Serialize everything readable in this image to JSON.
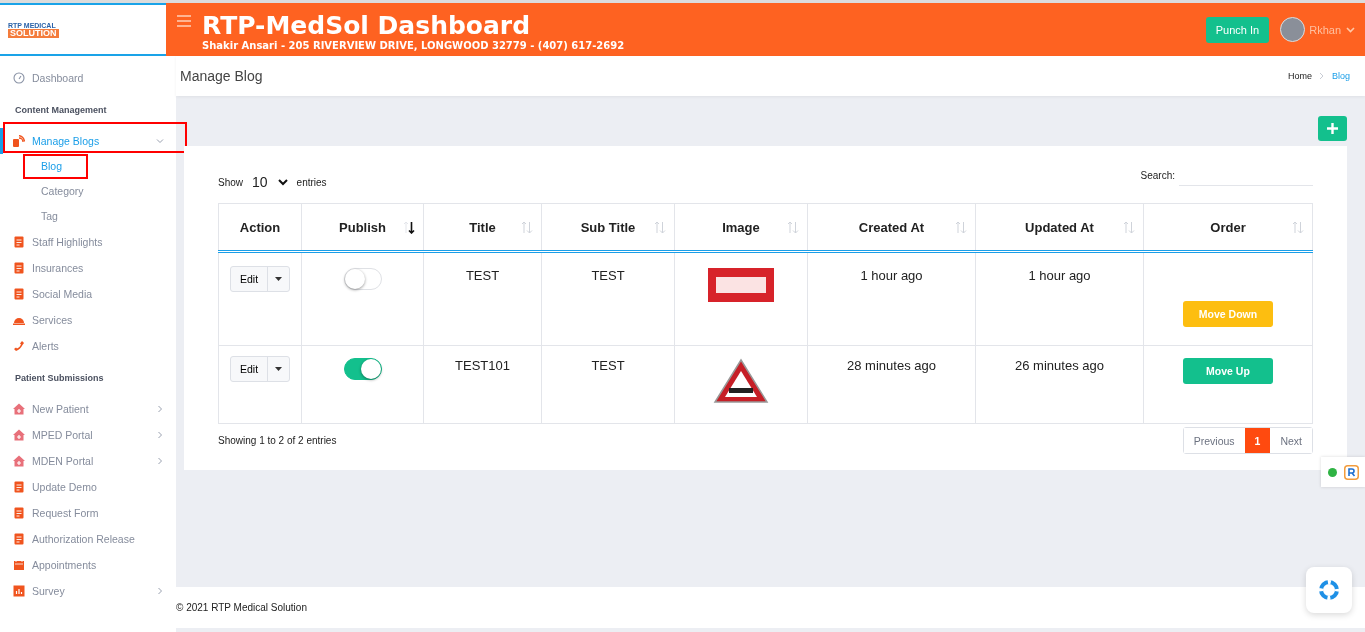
{
  "logo": {
    "line1": "RTP MEDICAL",
    "line2": "SOLUTION"
  },
  "header": {
    "title": "RTP-MedSol Dashboard",
    "subtitle": "Shakir Ansari - 205 RIVERVIEW DRIVE, LONGWOOD 32779 - (407) 617-2692",
    "punch_button": "Punch In",
    "user": "Rkhan"
  },
  "sidebar": {
    "items": [
      {
        "kind": "item",
        "label": "Dashboard",
        "selected": false
      },
      {
        "kind": "section",
        "label": "Content Management"
      },
      {
        "kind": "item",
        "label": "Manage Blogs",
        "selected": true,
        "highlighted": true,
        "expanded": true,
        "children": [
          {
            "label": "Blog",
            "selected": true,
            "highlighted": true
          },
          {
            "label": "Category",
            "selected": false
          },
          {
            "label": "Tag",
            "selected": false
          }
        ]
      },
      {
        "kind": "item",
        "label": "Staff Highlights",
        "selected": false
      },
      {
        "kind": "item",
        "label": "Insurances",
        "selected": false
      },
      {
        "kind": "item",
        "label": "Social Media",
        "selected": false
      },
      {
        "kind": "item",
        "label": "Services",
        "selected": false
      },
      {
        "kind": "item",
        "label": "Alerts",
        "selected": false
      },
      {
        "kind": "section",
        "label": "Patient Submissions"
      },
      {
        "kind": "item",
        "label": "New Patient",
        "selected": false,
        "expanded": false
      },
      {
        "kind": "item",
        "label": "MPED Portal",
        "selected": false,
        "expanded": false
      },
      {
        "kind": "item",
        "label": "MDEN Portal",
        "selected": false,
        "expanded": false
      },
      {
        "kind": "item",
        "label": "Update Demo",
        "selected": false
      },
      {
        "kind": "item",
        "label": "Request Form",
        "selected": false
      },
      {
        "kind": "item",
        "label": "Authorization Release",
        "selected": false
      },
      {
        "kind": "item",
        "label": "Appointments",
        "selected": false
      },
      {
        "kind": "item",
        "label": "Survey",
        "selected": false,
        "expanded": false
      }
    ]
  },
  "page": {
    "title": "Manage Blog",
    "breadcrumb": [
      {
        "label": "Home",
        "selected": false
      },
      {
        "label": "Blog",
        "selected": true
      }
    ]
  },
  "table": {
    "show_label": "Show",
    "page_size": "10",
    "entries_label": "entries",
    "search_label": "Search:",
    "columns": [
      {
        "label": "Action",
        "sortable": false
      },
      {
        "label": "Publish",
        "sortable": true,
        "sorted": true
      },
      {
        "label": "Title",
        "sortable": true,
        "sorted": false
      },
      {
        "label": "Sub Title",
        "sortable": true,
        "sorted": false
      },
      {
        "label": "Image",
        "sortable": true,
        "sorted": false
      },
      {
        "label": "Created At",
        "sortable": true,
        "sorted": false
      },
      {
        "label": "Updated At",
        "sortable": true,
        "sorted": false
      },
      {
        "label": "Order",
        "sortable": true,
        "sorted": false
      }
    ],
    "rows": [
      {
        "action": "Edit",
        "published": false,
        "title": "TEST",
        "sub_title": "TEST",
        "image": {
          "kind": "banner"
        },
        "created_at": "1 hour ago",
        "updated_at": "1 hour ago",
        "order": {
          "kind": "down",
          "label": "Move Down"
        }
      },
      {
        "action": "Edit",
        "published": true,
        "title": "TEST101",
        "sub_title": "TEST",
        "image": {
          "kind": "sign"
        },
        "created_at": "28 minutes ago",
        "updated_at": "26 minutes ago",
        "order": {
          "kind": "up",
          "label": "Move Up"
        }
      }
    ],
    "info": "Showing 1 to 2 of 2 entries",
    "pagination": [
      {
        "label": "Previous",
        "selected": false
      },
      {
        "label": "1",
        "selected": true
      },
      {
        "label": "Next",
        "selected": false
      }
    ]
  },
  "footer": "© 2021 RTP Medical Solution"
}
